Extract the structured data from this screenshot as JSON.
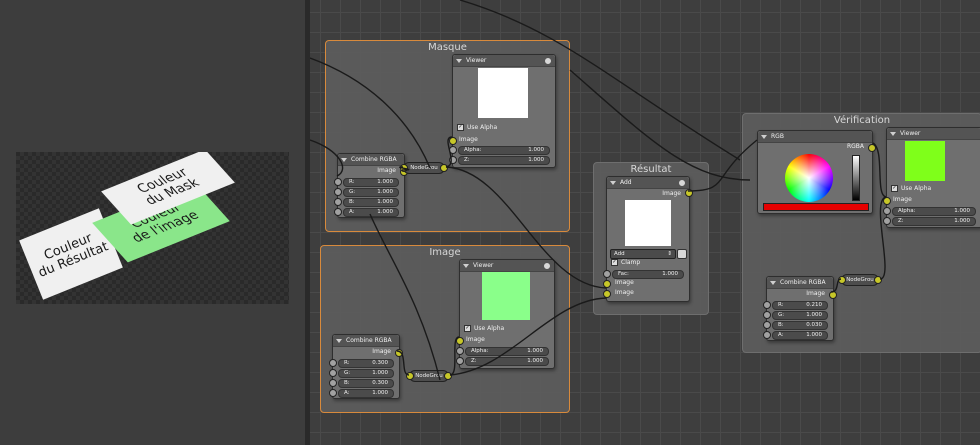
{
  "preview": {
    "cards": [
      {
        "id": "resultat",
        "line1": "Couleur",
        "line2": "du Résultat",
        "color": "#f0f0f0"
      },
      {
        "id": "image",
        "line1": "Couleur",
        "line2": "de l'image",
        "color": "#8ae68a"
      },
      {
        "id": "mask",
        "line1": "Couleur",
        "line2": "du Mask",
        "color": "#f0f0f0"
      }
    ]
  },
  "frames": {
    "masque": "Masque",
    "image": "Image",
    "resultat": "Résultat",
    "verification": "Vérification"
  },
  "nodes": {
    "combine_masque": {
      "title": "Combine RGBA",
      "out": "Image",
      "inputs": [
        {
          "label": "R:",
          "value": "1.000"
        },
        {
          "label": "G:",
          "value": "1.000"
        },
        {
          "label": "B:",
          "value": "1.000"
        },
        {
          "label": "A:",
          "value": "1.000"
        }
      ]
    },
    "combine_image": {
      "title": "Combine RGBA",
      "out": "Image",
      "inputs": [
        {
          "label": "R:",
          "value": "0.300"
        },
        {
          "label": "G:",
          "value": "1.000"
        },
        {
          "label": "B:",
          "value": "0.300"
        },
        {
          "label": "A:",
          "value": "1.000"
        }
      ]
    },
    "combine_verif": {
      "title": "Combine RGBA",
      "out": "Image",
      "inputs": [
        {
          "label": "R:",
          "value": "0.210"
        },
        {
          "label": "G:",
          "value": "1.000"
        },
        {
          "label": "B:",
          "value": "0.030"
        },
        {
          "label": "A:",
          "value": "1.000"
        }
      ]
    },
    "viewer_masque": {
      "title": "Viewer",
      "use_alpha": "Use Alpha",
      "image": "Image",
      "alpha_label": "Alpha:",
      "alpha": "1.000",
      "z_label": "Z:",
      "z": "1.000",
      "preview_color": "#ffffff"
    },
    "viewer_image": {
      "title": "Viewer",
      "use_alpha": "Use Alpha",
      "image": "Image",
      "alpha_label": "Alpha:",
      "alpha": "1.000",
      "z_label": "Z:",
      "z": "1.000",
      "preview_color": "#8aff8a"
    },
    "viewer_verif": {
      "title": "Viewer",
      "use_alpha": "Use Alpha",
      "image": "Image",
      "alpha_label": "Alpha:",
      "alpha": "1.000",
      "z_label": "Z:",
      "z": "1.000",
      "preview_color": "#7fff1a"
    },
    "add": {
      "title": "Add",
      "out": "Image",
      "mode": "Add",
      "clamp": "Clamp",
      "fac_label": "Fac:",
      "fac": "1.000",
      "in1": "Image",
      "in2": "Image",
      "preview_color": "#ffffff"
    },
    "rgb": {
      "title": "RGB",
      "out": "RGBA",
      "swatch_color": "#e60000"
    },
    "reroutes": {
      "masque": "NodeGrou",
      "image": "NodeGrou",
      "verif": "NodeGrou"
    }
  }
}
